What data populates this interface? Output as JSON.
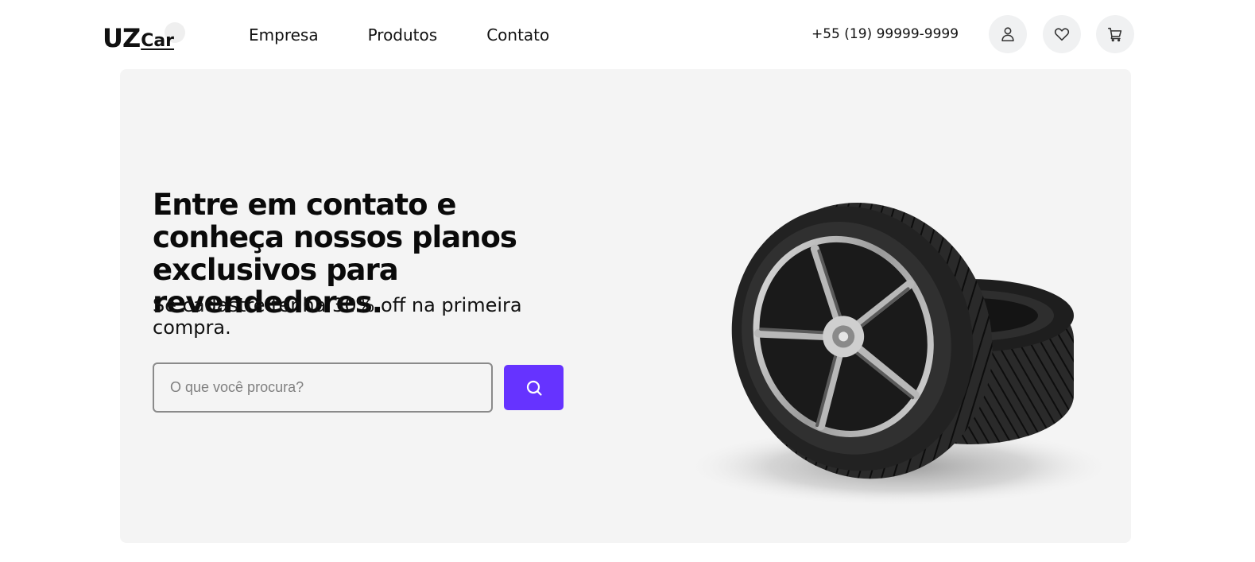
{
  "header": {
    "logo": {
      "primary": "UZ",
      "secondary": "Car"
    },
    "nav": [
      {
        "label": "Empresa"
      },
      {
        "label": "Produtos"
      },
      {
        "label": "Contato"
      }
    ],
    "phone": "+55 (19) 99999-9999",
    "icons": [
      "user-icon",
      "heart-icon",
      "cart-icon"
    ]
  },
  "hero": {
    "title": "Entre em contato e conheça nossos planos exclusivos para revendedores.",
    "subtitle": "Se cadastre tenha 30% off na primeira compra.",
    "search": {
      "placeholder": "O que você procura?",
      "value": ""
    },
    "image": "tires-image"
  },
  "colors": {
    "accent": "#6633ff",
    "hero_background": "#f4f4f4",
    "icon_button_background": "#f0f1f2",
    "text": "#111111"
  }
}
